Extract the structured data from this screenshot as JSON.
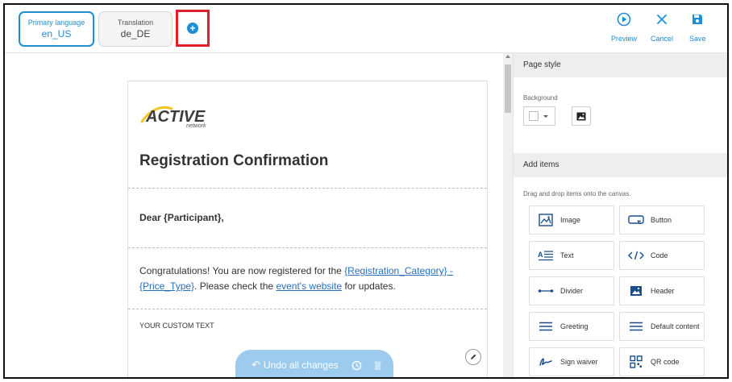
{
  "languages": {
    "primary": {
      "caption": "Primary language",
      "code": "en_US"
    },
    "translation": {
      "caption": "Translation",
      "code": "de_DE"
    },
    "add_symbol": "+"
  },
  "actions": {
    "preview": "Preview",
    "cancel": "Cancel",
    "save": "Save"
  },
  "email": {
    "logo_text": "ACTIVE",
    "logo_sub": "network",
    "title": "Registration Confirmation",
    "greeting": "Dear {Participant},",
    "body_start": "Congratulations! You are now registered for the ",
    "link_category": "{Registration_Category} - {Price_Type}",
    "body_middle": ". Please check the ",
    "link_website": "event's website",
    "body_end": " for updates.",
    "custom_text": "YOUR CUSTOM TEXT"
  },
  "undo": {
    "label": "Undo all changes"
  },
  "panel": {
    "page_style": "Page style",
    "background_label": "Background",
    "add_items": "Add items",
    "hint": "Drag and drop items onto the canvas.",
    "items": [
      {
        "label": "Image",
        "icon": "image-icon"
      },
      {
        "label": "Button",
        "icon": "button-icon"
      },
      {
        "label": "Text",
        "icon": "text-icon"
      },
      {
        "label": "Code",
        "icon": "code-icon"
      },
      {
        "label": "Divider",
        "icon": "divider-icon"
      },
      {
        "label": "Header",
        "icon": "header-icon"
      },
      {
        "label": "Greeting",
        "icon": "greeting-icon"
      },
      {
        "label": "Default content",
        "icon": "default-content-icon"
      },
      {
        "label": "Sign waiver",
        "icon": "signature-icon"
      },
      {
        "label": "QR code",
        "icon": "qr-code-icon"
      }
    ]
  },
  "colors": {
    "accent": "#1d8fd3",
    "highlight": "#e0202a",
    "undo_bar": "#9dcbee",
    "icon_dark": "#1a4d8c"
  }
}
